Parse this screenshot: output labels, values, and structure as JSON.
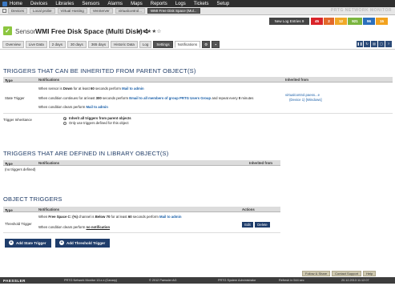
{
  "nav": {
    "items": [
      "Home",
      "Devices",
      "Libraries",
      "Sensors",
      "Alarms",
      "Maps",
      "Reports",
      "Logs",
      "Tickets",
      "Setup"
    ]
  },
  "breadcrumb": {
    "items": [
      "Devices",
      "Local probe",
      "Virtual Hosting",
      "VenServer",
      "virtualcontrol...",
      "WMI Free Disk Space (Mul..."
    ],
    "brand": "PRTG NETWORK MONITOR"
  },
  "header": {
    "check": "✓",
    "sensor_label": "Sensor",
    "sensor_name": "WMI Free Disk Space (Multi Disk) 4",
    "stars": "★★★★☆",
    "log_button": "New Log Entries 9",
    "stats": [
      {
        "label": "45",
        "color": "#d9242a"
      },
      {
        "label": "2",
        "color": "#e2682b"
      },
      {
        "label": "12",
        "color": "#f0a928"
      },
      {
        "label": "921",
        "color": "#7ab53f"
      },
      {
        "label": "96",
        "color": "#2b6fbc"
      },
      {
        "label": "15",
        "color": "#f2a21e"
      }
    ]
  },
  "tabs": [
    "Overview",
    "Live Data",
    "2 days",
    "30 days",
    "365 days",
    "Historic Data",
    "Log",
    "Settings",
    "Notifications"
  ],
  "sections": {
    "inherited_title": "TRIGGERS THAT CAN BE INHERITED FROM PARENT OBJECT(S)",
    "library_title": "TRIGGERS THAT ARE DEFINED IN LIBRARY OBJECT(S)",
    "object_title": "OBJECT TRIGGERS"
  },
  "inherited_table": {
    "headers": {
      "type": "Type",
      "notifications": "Notifications",
      "inherited": "Inherited from"
    },
    "row_type": "State Trigger",
    "line1": {
      "a": "When sensor is ",
      "b": "Down",
      "c": " for at least ",
      "d": "60",
      "e": " seconds perform ",
      "f": "Mail to admin"
    },
    "line2": {
      "a": "When condition continues for at least ",
      "b": "300",
      "c": " seconds perform ",
      "d": "Email to all members of group PRTG Users Group",
      "e": " and repeat every ",
      "f": "0",
      "g": " minutes"
    },
    "line3": {
      "a": "When condition clears perform ",
      "b": "Mail to admin"
    },
    "inherited_from_link": "virtualcontrol.paess...e",
    "inherited_from_rest": "(Device 1) [Windows]",
    "inheritance_label": "Trigger Inheritance",
    "option1": "Inherit all triggers from parent objects",
    "option2": "Only use triggers defined for this object"
  },
  "library_table": {
    "headers": {
      "type": "Type",
      "notifications": "Notifications",
      "inherited": "Inherited from"
    },
    "empty": "(no triggers defined)"
  },
  "object_table": {
    "headers": {
      "type": "Type",
      "notifications": "Notifications",
      "actions": "Actions"
    },
    "row_type": "Threshold Trigger",
    "line1": {
      "a": "When ",
      "b": "Free Space C: (%)",
      "c": " channel is ",
      "d": "Below",
      "e": " ",
      "f": "70",
      "g": " for at least ",
      "h": "60",
      "i": " seconds perform ",
      "j": "Mail to admin"
    },
    "line2": {
      "a": "When condition clears perform ",
      "b": "no notification"
    },
    "edit": "Edit",
    "delete": "Delete"
  },
  "buttons": {
    "add_state": "Add State Trigger",
    "add_threshold": "Add Threshold Trigger",
    "follow": "Follow & Share",
    "contact": "Contact Support",
    "help": "Help"
  },
  "footer": {
    "logo": "PAESSLER",
    "version": "PRTG Network Monitor 13.x.x (Canary)",
    "copyright": "© 2012 Paessler AG",
    "user": "PRTG System Administrator",
    "refresh": "Refresh in 544 sec",
    "timestamp": "20.12.2013 11:12:07"
  }
}
